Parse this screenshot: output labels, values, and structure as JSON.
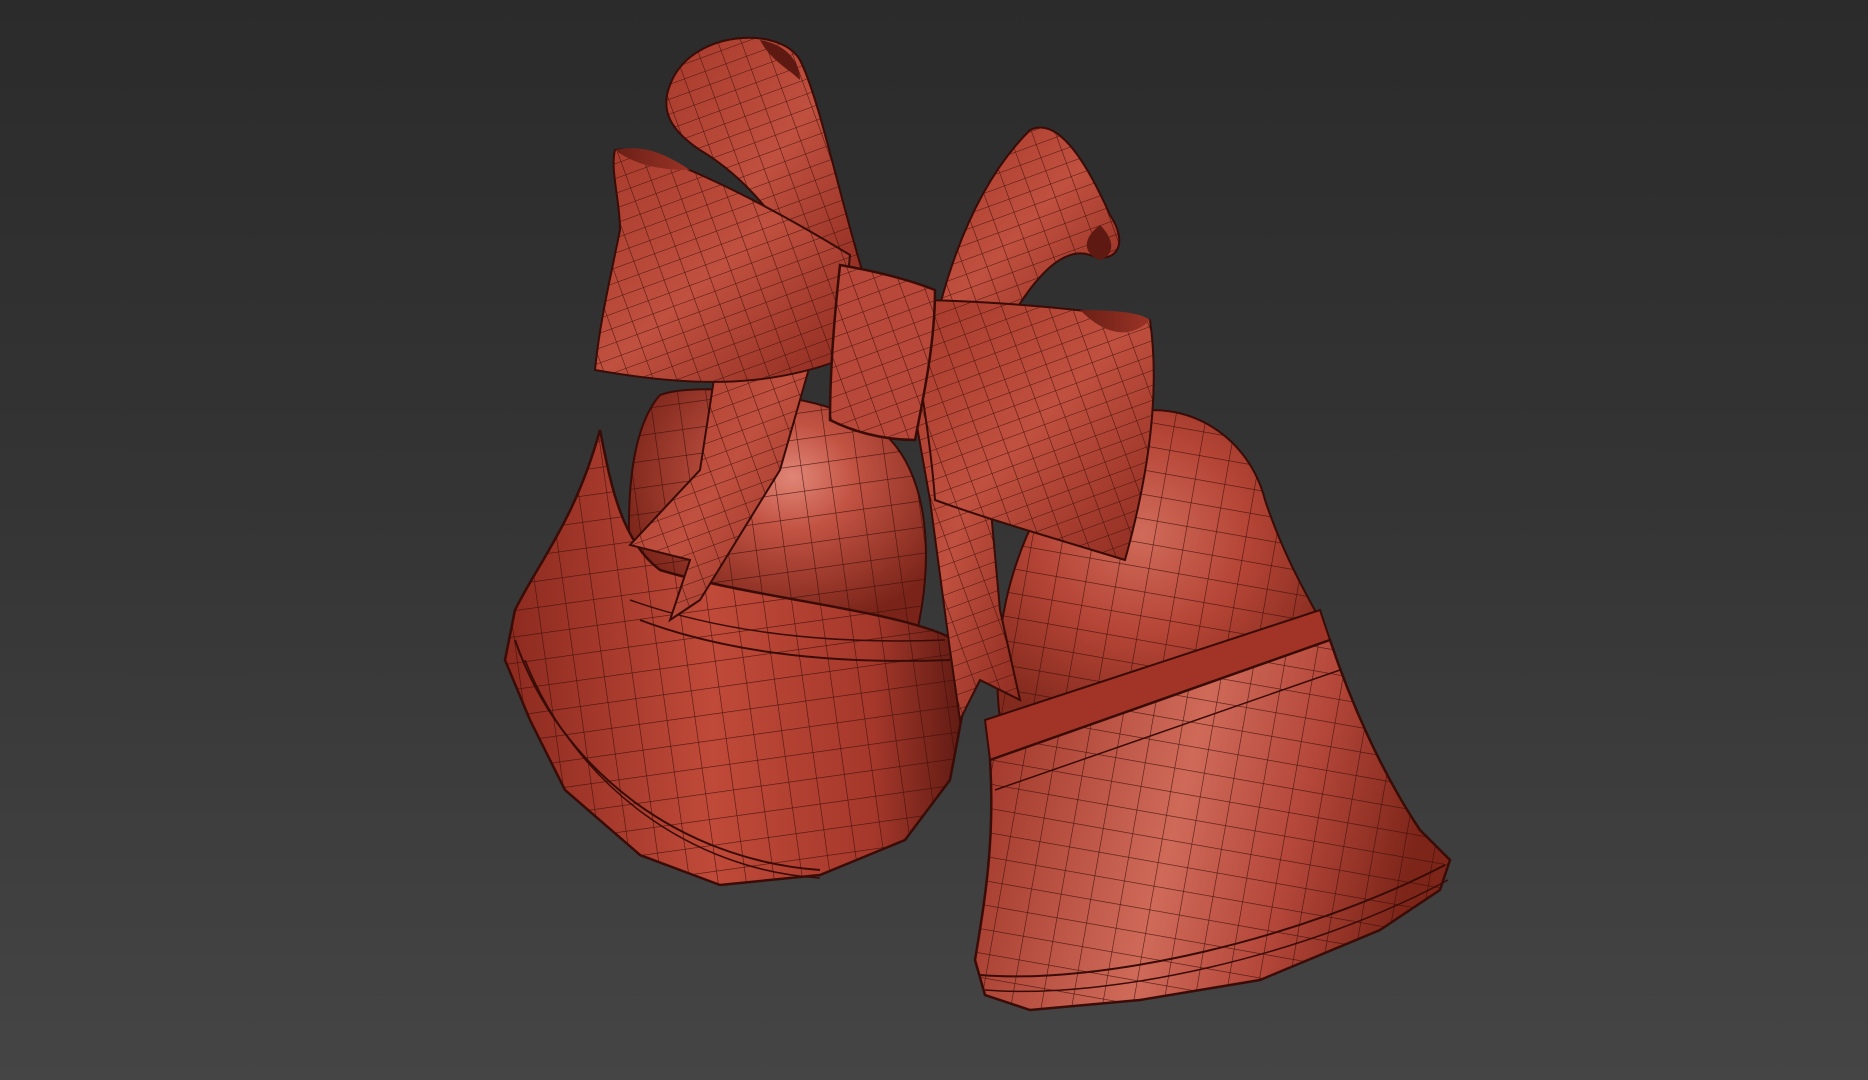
{
  "scene": {
    "subject": "two-bells-with-bow",
    "render_mode": "wireframe-on-shaded",
    "colors": {
      "background_top": "#2b2b2b",
      "background_bottom": "#454545",
      "material_base": "#b03f30",
      "material_light": "#d7705f",
      "material_dark": "#6e2017",
      "wire": "#3a0c07"
    }
  }
}
